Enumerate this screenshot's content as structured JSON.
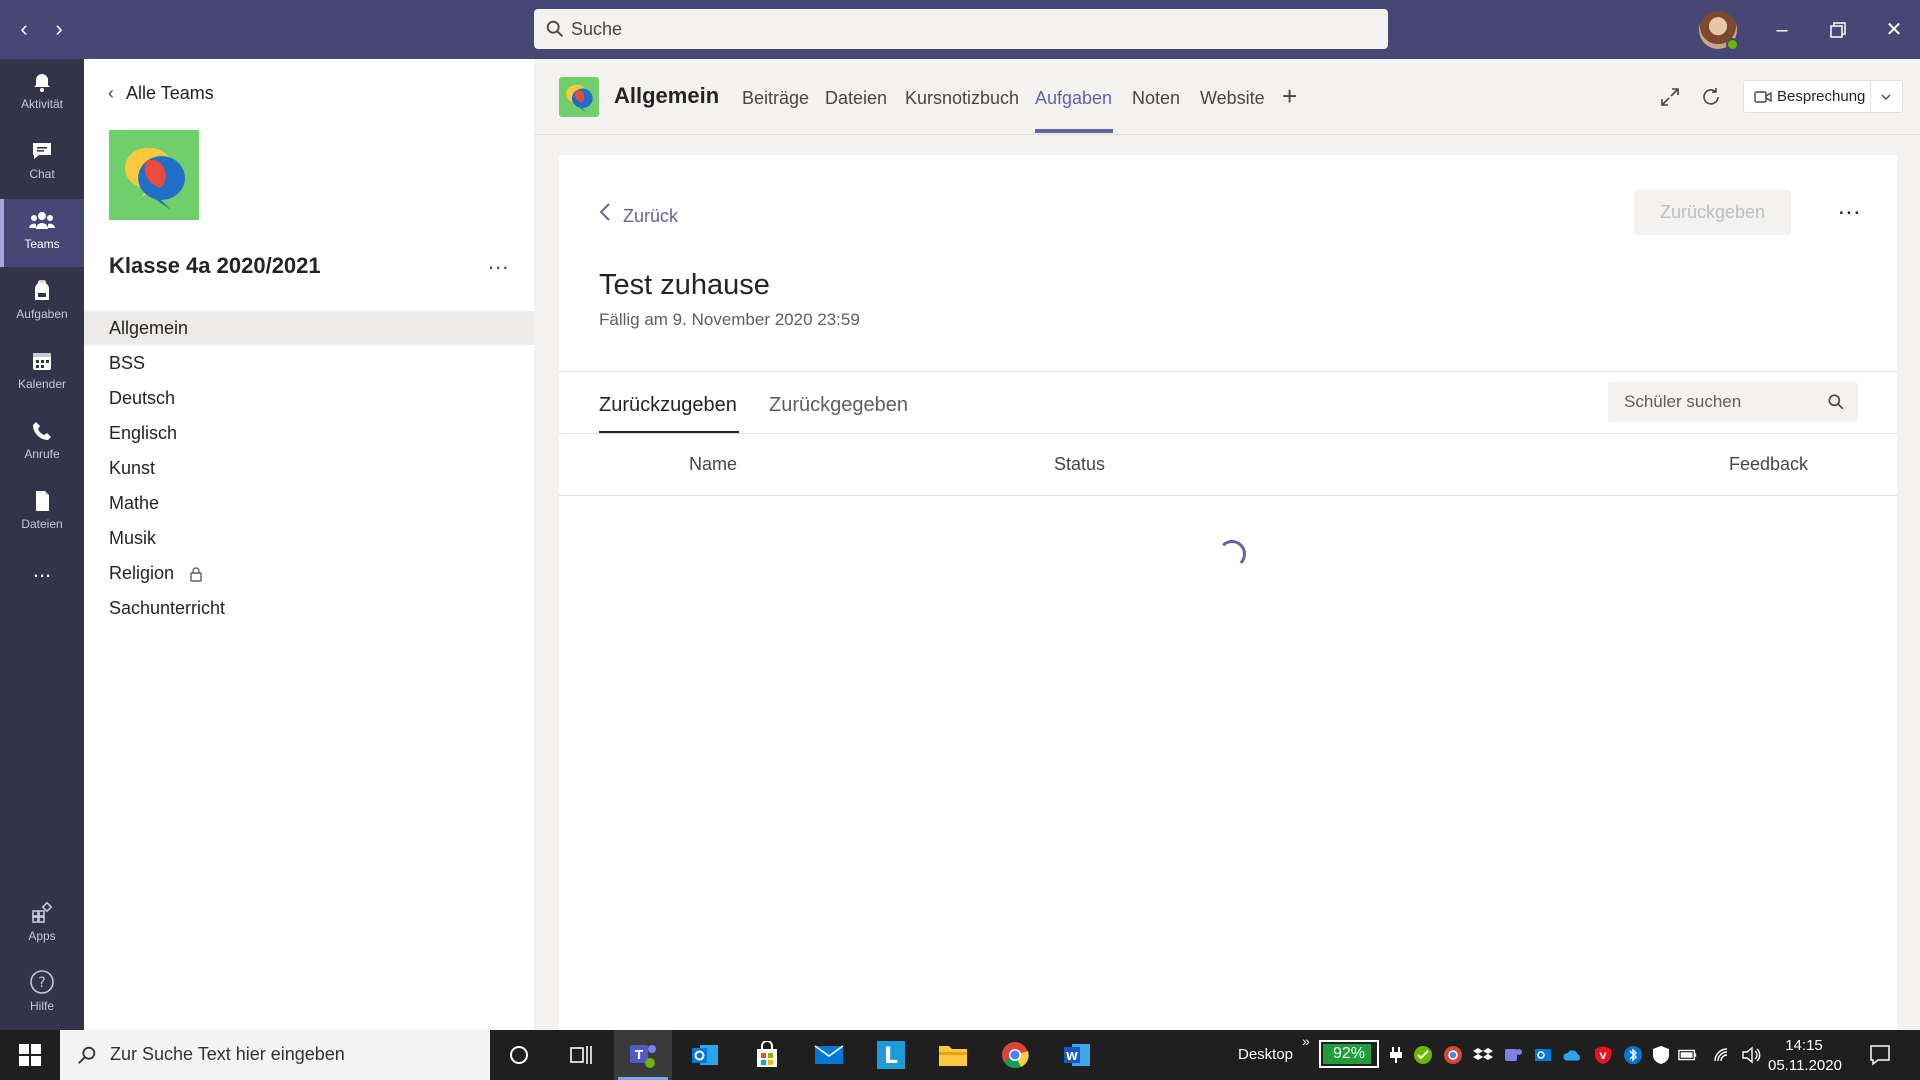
{
  "titlebar": {
    "search_placeholder": "Suche"
  },
  "rail": {
    "items": [
      {
        "label": "Aktivität"
      },
      {
        "label": "Chat"
      },
      {
        "label": "Teams"
      },
      {
        "label": "Aufgaben"
      },
      {
        "label": "Kalender"
      },
      {
        "label": "Anrufe"
      },
      {
        "label": "Dateien"
      },
      {
        "label": "Apps"
      },
      {
        "label": "Hilfe"
      }
    ],
    "more": "..."
  },
  "team_panel": {
    "back_label": "Alle Teams",
    "team_name": "Klasse 4a 2020/2021",
    "more": "...",
    "channels": [
      {
        "label": "Allgemein"
      },
      {
        "label": "BSS"
      },
      {
        "label": "Deutsch"
      },
      {
        "label": "Englisch"
      },
      {
        "label": "Kunst"
      },
      {
        "label": "Mathe"
      },
      {
        "label": "Musik"
      },
      {
        "label": "Religion"
      },
      {
        "label": "Sachunterricht"
      }
    ]
  },
  "channel_header": {
    "name": "Allgemein",
    "tabs": [
      {
        "label": "Beiträge"
      },
      {
        "label": "Dateien"
      },
      {
        "label": "Kursnotizbuch"
      },
      {
        "label": "Aufgaben"
      },
      {
        "label": "Noten"
      },
      {
        "label": "Website"
      }
    ],
    "add_tab": "+",
    "meeting_label": "Besprechung"
  },
  "assignment": {
    "back_label": "Zurück",
    "return_button": "Zurückgeben",
    "more": "...",
    "title": "Test zuhause",
    "due": "Fällig am 9. November 2020 23:59",
    "subtabs": [
      {
        "label": "Zurückzugeben"
      },
      {
        "label": "Zurückgegeben"
      }
    ],
    "student_search_placeholder": "Schüler suchen",
    "columns": {
      "name": "Name",
      "status": "Status",
      "feedback": "Feedback"
    }
  },
  "taskbar": {
    "search_placeholder": "Zur Suche Text hier eingeben",
    "desktop_label": "Desktop",
    "overflow": "»",
    "battery_percent": "92%",
    "battery_level": 0.92,
    "time": "14:15",
    "date": "05.11.2020"
  },
  "colors": {
    "titlebar": "#464775",
    "rail": "#33344a",
    "accent": "#6264a7",
    "team_logo": "#6fcf6a"
  }
}
